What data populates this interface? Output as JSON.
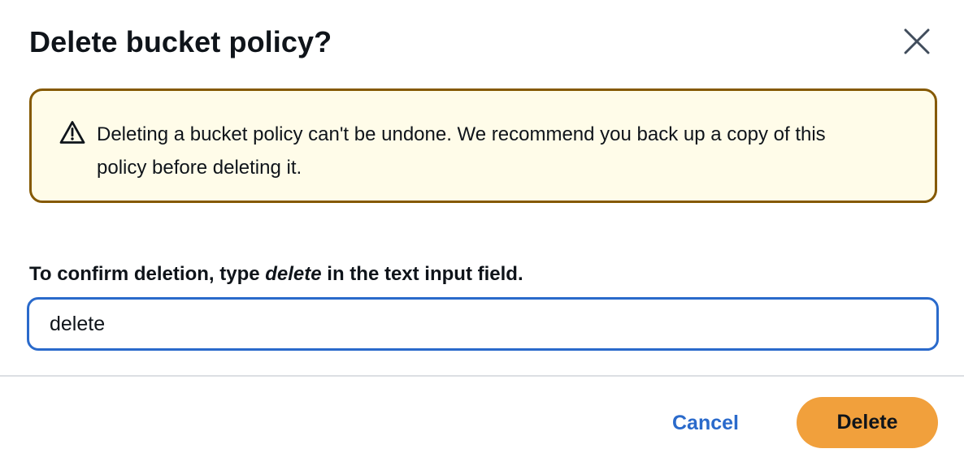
{
  "modal": {
    "title": "Delete bucket policy?",
    "close_icon": "close-icon"
  },
  "alert": {
    "type": "warning",
    "icon": "warning-triangle-icon",
    "text": "Deleting a bucket policy can't be undone. We recommend you back up a copy of this policy before deleting it.",
    "border_color": "#855900",
    "background_color": "#fffce9"
  },
  "confirm": {
    "label_prefix": "To confirm deletion, type ",
    "label_keyword": "delete",
    "label_suffix": " in the text input field.",
    "input_value": "delete",
    "input_border_color": "#2a6acb"
  },
  "footer": {
    "cancel_label": "Cancel",
    "delete_label": "Delete",
    "link_color": "#2a6acb",
    "primary_color": "#f1a03c"
  }
}
